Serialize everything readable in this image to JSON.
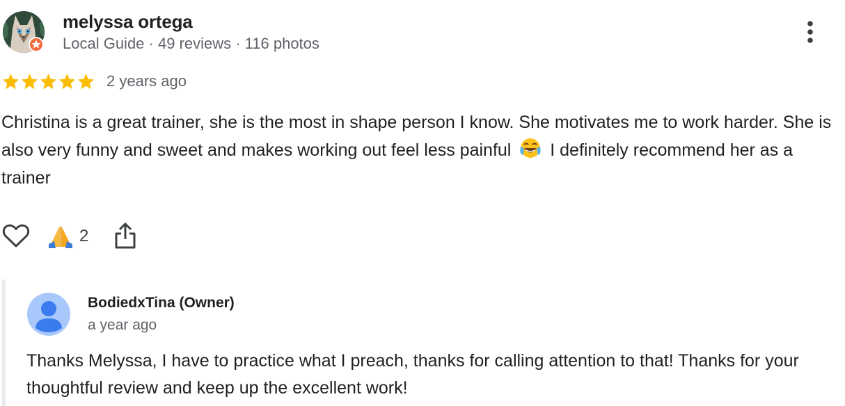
{
  "review": {
    "reviewer_name": "melyssa ortega",
    "reviewer_meta": "Local Guide · 49 reviews · 116 photos",
    "rating": 5,
    "max_rating": 5,
    "time_ago": "2 years ago",
    "text_part1": "Christina is a great trainer, she is the most in shape person I know. She motivates me to work harder. She is also very funny and sweet and makes working out feel less painful",
    "text_emoji": "😂",
    "text_part2": "I definitely recommend her as a trainer",
    "actions": {
      "like_icon": "heart-outline-icon",
      "reaction_icon": "folded-hands-emoji",
      "reaction_count": "2",
      "share_icon": "share-icon"
    },
    "more_icon": "more-vert-icon",
    "star_color": "#fbbc04",
    "local_guide_badge_color": "#f26b3a"
  },
  "owner_reply": {
    "name": "BodiedxTina (Owner)",
    "time_ago": "a year ago",
    "text": "Thanks Melyssa, I have to practice what I preach, thanks for calling attention to that! Thanks for your thoughtful review and keep up the excellent work!",
    "avatar_icon": "default-person-icon",
    "avatar_color": "#a8c7fa"
  }
}
